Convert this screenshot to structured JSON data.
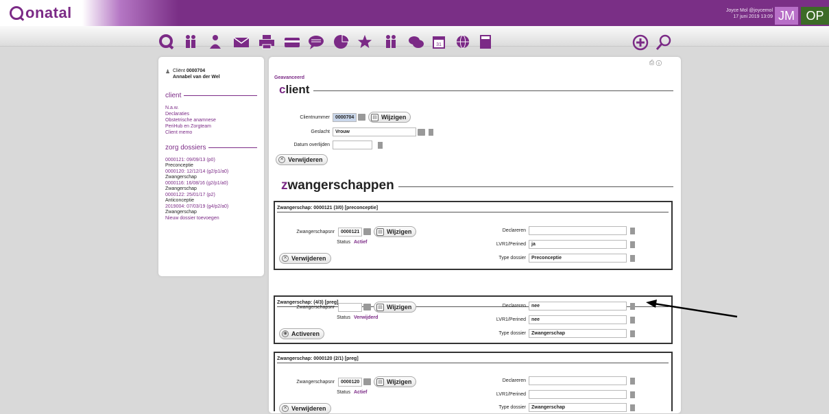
{
  "topbar": {
    "logo_text": "onatal",
    "user_name": "Joyce Mol @joycemol",
    "datetime": "17 juni 2019 13:09",
    "badge1": "JM",
    "badge2": "OP",
    "colors": {
      "brand": "#7b2a86",
      "badge1": "#b86fc8",
      "badge2": "#3d6b27"
    }
  },
  "iconbar": {
    "icons": [
      "q-logo-icon",
      "people-icon",
      "person-icon",
      "mail-icon",
      "print-icon",
      "card-icon",
      "speech-bubble-icon",
      "pie-chart-icon",
      "star-icon",
      "group-icon",
      "chat-icon",
      "calendar-icon",
      "globe-icon",
      "calculator-icon",
      "add-circle-icon",
      "magnifier-icon"
    ]
  },
  "sidebar": {
    "client_label": "Cliënt",
    "client_number": "0000704",
    "client_name": "Annabel van der Wel",
    "client_section": "client",
    "client_links": [
      "N.a.w.",
      "Declaraties",
      "Obstetrische anamnese",
      "PeriHub en Zorgteam",
      "Client memo"
    ],
    "zorg_section": "zorg dossiers",
    "dossiers": [
      {
        "link": "0000121: 09/09/13 (p0)",
        "type": "Preconceptie"
      },
      {
        "link": "0000120: 12/12/14 (g2/p1/a0)",
        "type": "Zwangerschap"
      },
      {
        "link": "0000116: 16/08/16 (g2/p1/a0)",
        "type": "Zwangerschap"
      },
      {
        "link": "0000122: 25/01/17 (p2)",
        "type": "Anticonceptie"
      },
      {
        "link": "2019004: 07/03/19 (g4/p2/a0)",
        "type": "Zwangerschap"
      }
    ],
    "new_dossier": "Nieuw dossier toevoegen"
  },
  "main": {
    "breadcrumb": "Geavanceerd",
    "client_heading_first": "c",
    "client_heading_rest": "lient",
    "clientnummer_label": "Clientnummer",
    "clientnummer_value": "0000704",
    "wijzigen": "Wijzigen",
    "geslacht_label": "Geslacht",
    "geslacht_value": "Vrouw",
    "overlijden_label": "Datum overlijden",
    "overlijden_value": "",
    "verwijderen": "Verwijderen",
    "zw_heading_first": "z",
    "zw_heading_rest": "wangerschappen"
  },
  "pregnancies": [
    {
      "title": "Zwangerschap: 0000121 (3/0) [preconceptie]",
      "nr_label": "Zwangerschapsnr",
      "nr_value": "0000121",
      "wijzigen": "Wijzigen",
      "status_label": "Status",
      "status_value": "Actief",
      "action": "Verwijderen",
      "declareren_label": "Declareren",
      "declareren_value": "",
      "lvr_label": "LVR1/Perined",
      "lvr_value": "ja",
      "type_label": "Type dossier",
      "type_value": "Preconceptie"
    },
    {
      "title": "Zwangerschap: (4/3) [preg]",
      "nr_label": "Zwangerschapsnr",
      "nr_value": "",
      "wijzigen": "Wijzigen",
      "status_label": "Status",
      "status_value": "Verwijderd",
      "action": "Activeren",
      "declareren_label": "Declareren",
      "declareren_value": "nee",
      "lvr_label": "LVR1/Perined",
      "lvr_value": "nee",
      "type_label": "Type dossier",
      "type_value": "Zwangerschap"
    },
    {
      "title": "Zwangerschap: 0000120 (2/1) [preg]",
      "nr_label": "Zwangerschapsnr",
      "nr_value": "0000120",
      "wijzigen": "Wijzigen",
      "status_label": "Status",
      "status_value": "Actief",
      "action": "Verwijderen",
      "declareren_label": "Declareren",
      "declareren_value": "",
      "lvr_label": "LVR1/Perined",
      "lvr_value": "",
      "type_label": "Type dossier",
      "type_value": "Zwangerschap"
    }
  ]
}
